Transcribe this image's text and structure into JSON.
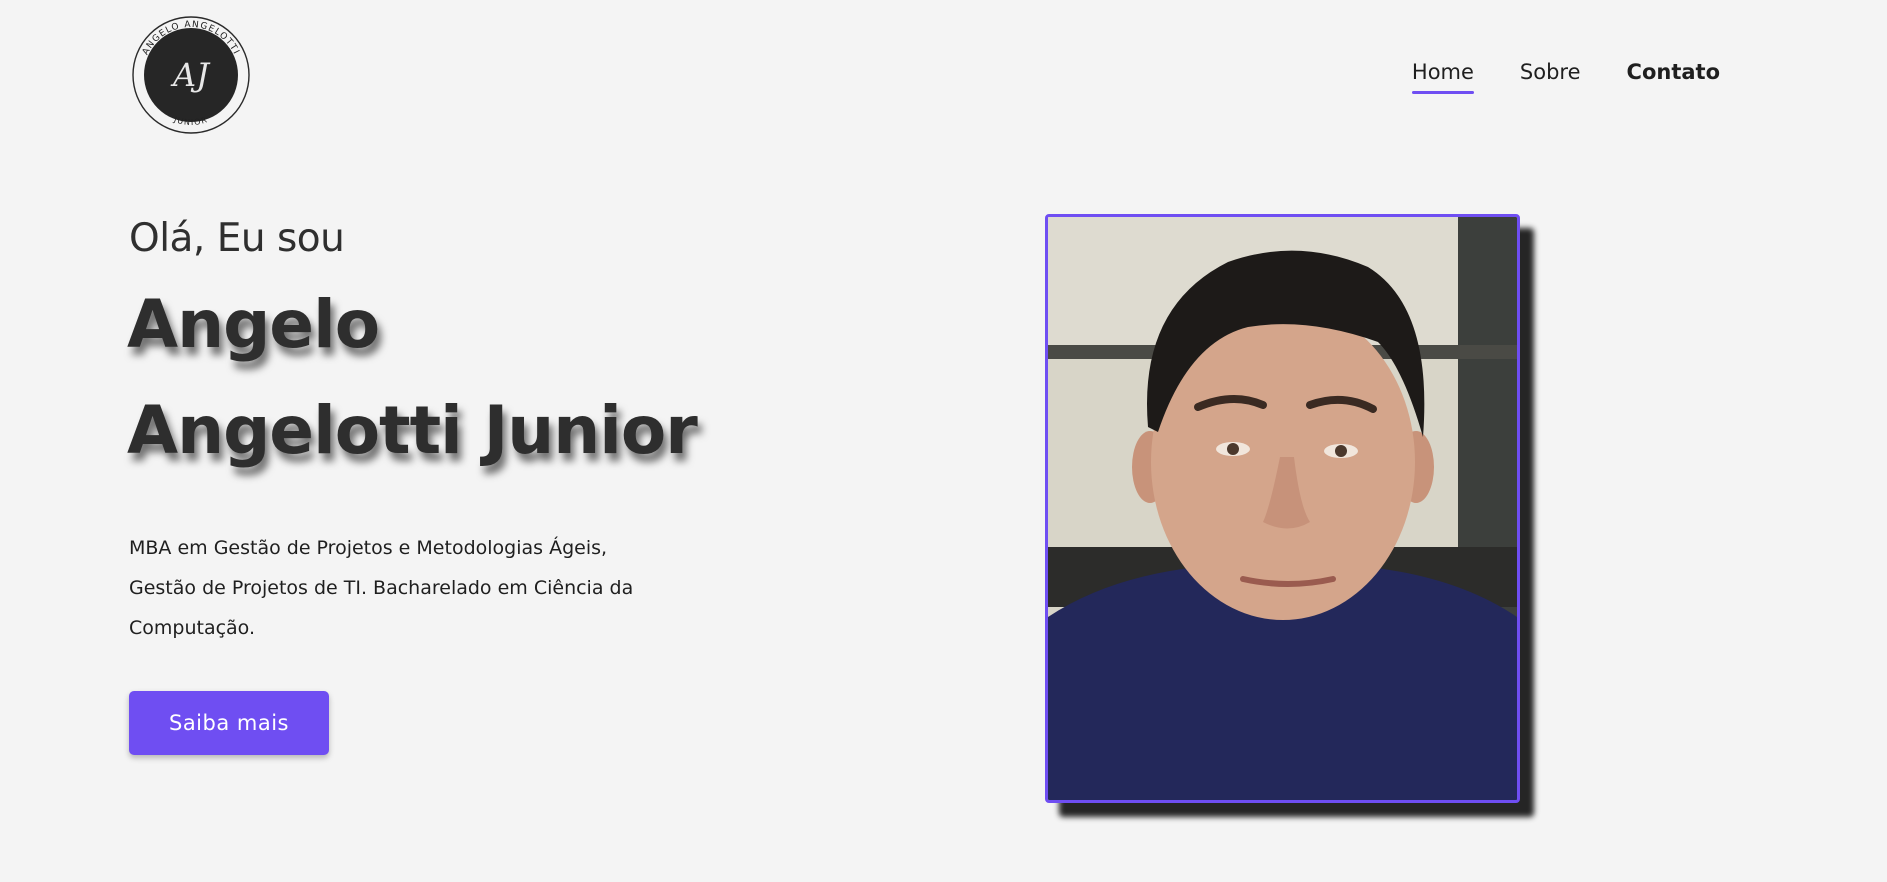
{
  "header": {
    "logo": {
      "ring_text_top": "ANGELO ANGELOTTI",
      "monogram": "AJ",
      "ring_text_bottom": "JUNIOR"
    },
    "nav": [
      {
        "label": "Home",
        "active": true
      },
      {
        "label": "Sobre",
        "active": false
      },
      {
        "label": "Contato",
        "active": false
      }
    ]
  },
  "hero": {
    "greeting": "Olá, Eu sou",
    "name_line1": "Angelo",
    "name_line2": "Angelotti Junior",
    "description": "MBA em Gestão de Projetos e Metodologias Ágeis, Gestão de Projetos de TI. Bacharelado em Ciência da Computação.",
    "cta_label": "Saiba mais"
  },
  "colors": {
    "accent": "#6f4ef2",
    "background": "#f4f4f4",
    "text": "#2e2e2e"
  }
}
